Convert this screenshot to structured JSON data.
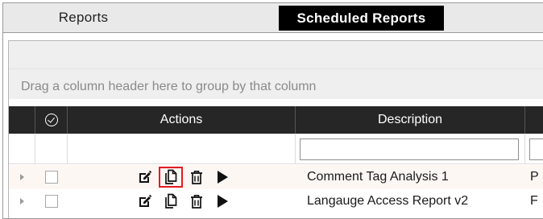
{
  "tabs": [
    {
      "label": "Reports",
      "active": false
    },
    {
      "label": "Scheduled Reports",
      "active": true
    }
  ],
  "grid": {
    "group_hint": "Drag a column header here to group by that column",
    "columns": {
      "select_icon": "circle-check-icon",
      "actions": "Actions",
      "description": "Description",
      "next_partial": ""
    },
    "filter": {
      "description_value": "",
      "next_value": ""
    },
    "rows": [
      {
        "description": "Comment Tag Analysis 1",
        "next_partial": "P",
        "copy_highlighted": true
      },
      {
        "description": "Langauge Access Report v2",
        "next_partial": "F",
        "copy_highlighted": false
      }
    ],
    "action_icons": [
      "edit-icon",
      "copy-icon",
      "trash-icon",
      "play-icon"
    ]
  },
  "colors": {
    "header_bg": "#262626",
    "active_tab_bg": "#000000",
    "highlight_border": "#e31b23",
    "hover_row_bg": "#fdf7f4"
  }
}
